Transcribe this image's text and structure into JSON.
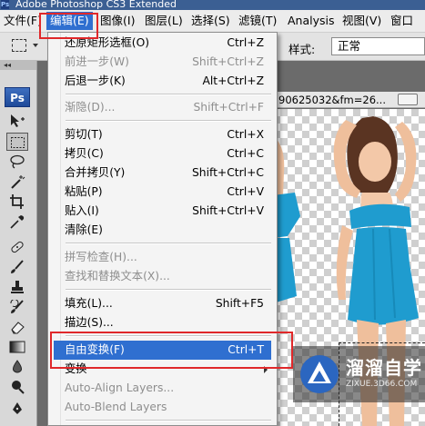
{
  "window": {
    "title": "Adobe Photoshop CS3 Extended",
    "app_badge": "Ps"
  },
  "menubar": {
    "items": [
      "文件(F)",
      "编辑(E)",
      "图像(I)",
      "图层(L)",
      "选择(S)",
      "滤镜(T)",
      "Analysis",
      "视图(V)",
      "窗口"
    ],
    "active": "编辑(E)"
  },
  "options": {
    "style_label": "样式:",
    "style_value": "正常"
  },
  "toolbox": {
    "logo": "Ps",
    "grip": "◂◂"
  },
  "document": {
    "title": "90625032&fm=26..."
  },
  "edit_menu": {
    "items": [
      {
        "label": "还原矩形选框(O)",
        "shortcut": "Ctrl+Z",
        "disabled": false
      },
      {
        "label": "前进一步(W)",
        "shortcut": "Shift+Ctrl+Z",
        "disabled": true
      },
      {
        "label": "后退一步(K)",
        "shortcut": "Alt+Ctrl+Z",
        "disabled": false
      },
      {
        "label": "渐隐(D)...",
        "shortcut": "Shift+Ctrl+F",
        "disabled": true
      },
      {
        "label": "剪切(T)",
        "shortcut": "Ctrl+X",
        "disabled": false
      },
      {
        "label": "拷贝(C)",
        "shortcut": "Ctrl+C",
        "disabled": false
      },
      {
        "label": "合并拷贝(Y)",
        "shortcut": "Shift+Ctrl+C",
        "disabled": false
      },
      {
        "label": "粘贴(P)",
        "shortcut": "Ctrl+V",
        "disabled": false
      },
      {
        "label": "贴入(I)",
        "shortcut": "Shift+Ctrl+V",
        "disabled": false
      },
      {
        "label": "清除(E)",
        "shortcut": "",
        "disabled": false
      },
      {
        "label": "拼写检查(H)...",
        "shortcut": "",
        "disabled": true
      },
      {
        "label": "查找和替换文本(X)...",
        "shortcut": "",
        "disabled": true
      },
      {
        "label": "填充(L)...",
        "shortcut": "Shift+F5",
        "disabled": false
      },
      {
        "label": "描边(S)...",
        "shortcut": "",
        "disabled": false
      },
      {
        "label": "自由变换(F)",
        "shortcut": "Ctrl+T",
        "disabled": false,
        "highlighted": true
      },
      {
        "label": "变换",
        "shortcut": "",
        "disabled": false,
        "submenu": true
      },
      {
        "label": "Auto-Align Layers...",
        "shortcut": "",
        "disabled": true
      },
      {
        "label": "Auto-Blend Layers",
        "shortcut": "",
        "disabled": true
      }
    ]
  },
  "watermark": {
    "title": "溜溜自学",
    "url": "ZIXUE.3D66.COM"
  },
  "colors": {
    "accent": "#2f6fd0",
    "annotation_red": "#e0282a",
    "dress": "#1f9ccf"
  }
}
